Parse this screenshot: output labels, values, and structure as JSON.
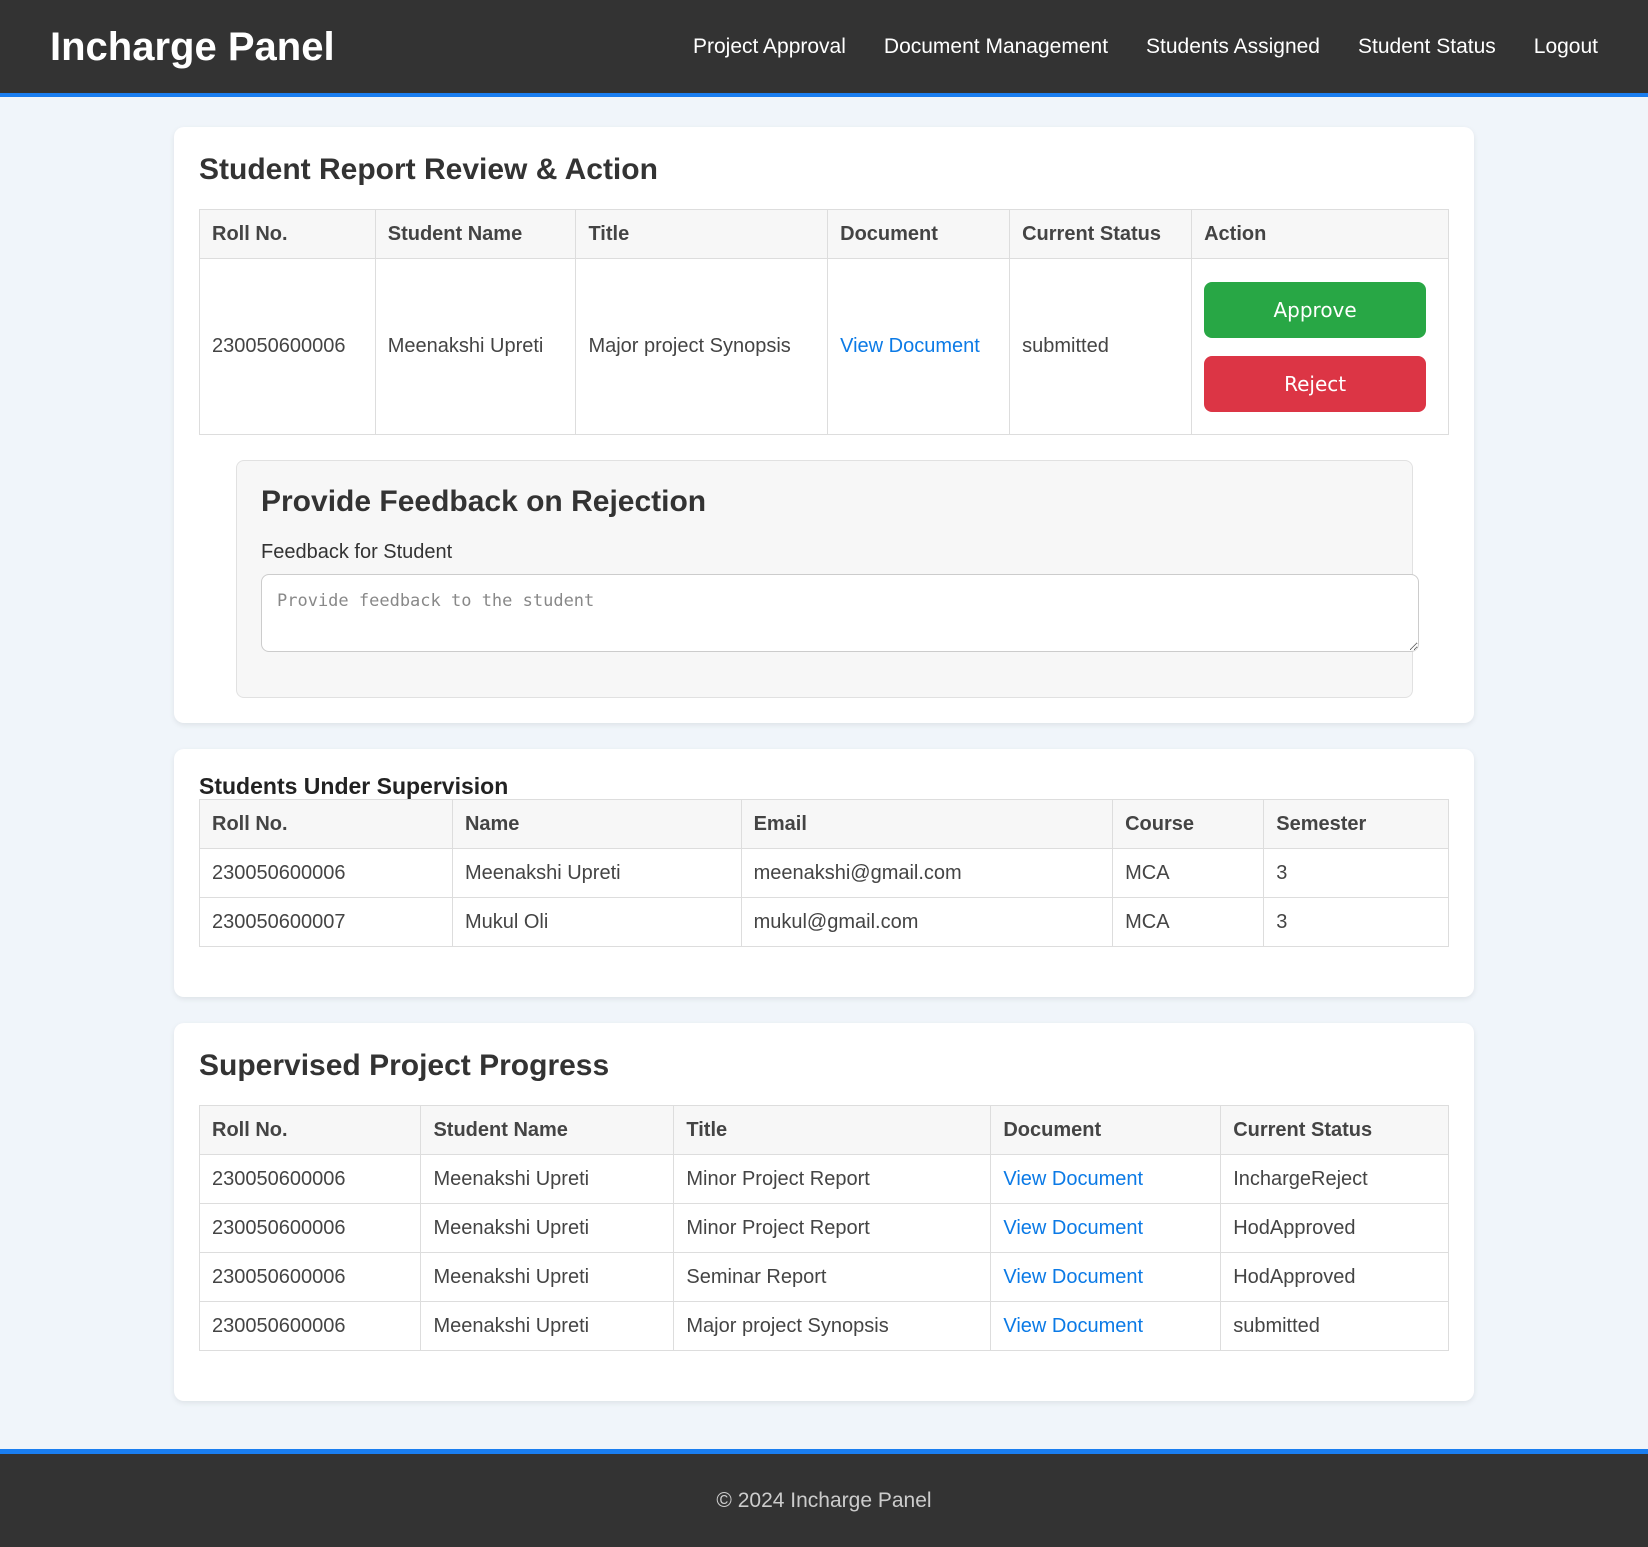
{
  "header": {
    "brand": "Incharge Panel",
    "nav": [
      "Project Approval",
      "Document Management",
      "Students Assigned",
      "Student Status",
      "Logout"
    ]
  },
  "review": {
    "title": "Student Report Review & Action",
    "columns": [
      "Roll No.",
      "Student Name",
      "Title",
      "Document",
      "Current Status",
      "Action"
    ],
    "row": {
      "roll": "230050600006",
      "name": "Meenakshi Upreti",
      "title": "Major project Synopsis",
      "document": "View Document",
      "status": "submitted"
    },
    "approve_label": "Approve",
    "reject_label": "Reject"
  },
  "feedback": {
    "title": "Provide Feedback on Rejection",
    "label": "Feedback for Student",
    "placeholder": "Provide feedback to the student",
    "value": ""
  },
  "students": {
    "title": "Students Under Supervision",
    "columns": [
      "Roll No.",
      "Name",
      "Email",
      "Course",
      "Semester"
    ],
    "rows": [
      {
        "roll": "230050600006",
        "name": "Meenakshi Upreti",
        "email": "meenakshi@gmail.com",
        "course": "MCA",
        "semester": "3"
      },
      {
        "roll": "230050600007",
        "name": "Mukul Oli",
        "email": "mukul@gmail.com",
        "course": "MCA",
        "semester": "3"
      }
    ]
  },
  "progress": {
    "title": "Supervised Project Progress",
    "columns": [
      "Roll No.",
      "Student Name",
      "Title",
      "Document",
      "Current Status"
    ],
    "rows": [
      {
        "roll": "230050600006",
        "name": "Meenakshi Upreti",
        "title": "Minor Project Report",
        "document": "View Document",
        "status": "InchargeReject"
      },
      {
        "roll": "230050600006",
        "name": "Meenakshi Upreti",
        "title": "Minor Project Report",
        "document": "View Document",
        "status": "HodApproved"
      },
      {
        "roll": "230050600006",
        "name": "Meenakshi Upreti",
        "title": "Seminar Report",
        "document": "View Document",
        "status": "HodApproved"
      },
      {
        "roll": "230050600006",
        "name": "Meenakshi Upreti",
        "title": "Major project Synopsis",
        "document": "View Document",
        "status": "submitted"
      }
    ]
  },
  "footer": {
    "text": "© 2024 Incharge Panel"
  },
  "colors": {
    "header_bg": "#333333",
    "accent_border": "#1a7ef0",
    "approve": "#28a745",
    "reject": "#dc3545",
    "link": "#0b7ae6",
    "page_bg": "#f0f5fa"
  }
}
